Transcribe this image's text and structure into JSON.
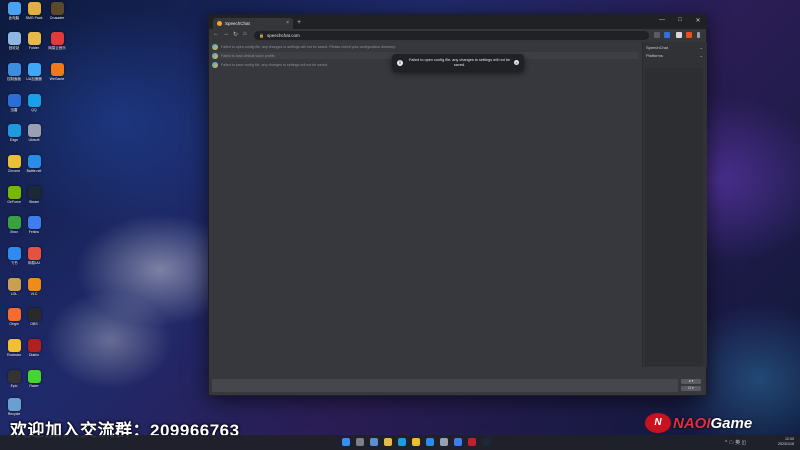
{
  "desktop": {
    "icons": [
      {
        "label": "此电脑",
        "color": "#4aa3f0"
      },
      {
        "label": "SMG Pack",
        "color": "#e0b040"
      },
      {
        "label": "Crusader",
        "color": "#5a4a2a"
      },
      {
        "label": "回收站",
        "color": "#8fb6e0"
      },
      {
        "label": "Folder",
        "color": "#e8b84a"
      },
      {
        "label": "网易云音乐",
        "color": "#e03a3a"
      },
      {
        "label": "控制面板",
        "color": "#3b8de0"
      },
      {
        "label": "UU加速器",
        "color": "#3fa7f5"
      },
      {
        "label": "WeGame",
        "color": "#f07a1a"
      },
      {
        "label": "迅雷",
        "color": "#2b6fd6"
      },
      {
        "label": "QQ",
        "color": "#1aa0e8"
      },
      {
        "label": "Edge",
        "color": "#1d9be0"
      },
      {
        "label": "Ubisoft",
        "color": "#9aa0b0"
      },
      {
        "label": "Chrome",
        "color": "#e8c030"
      },
      {
        "label": "Battle.net",
        "color": "#2a8de8"
      },
      {
        "label": "GeForce",
        "color": "#76b900"
      },
      {
        "label": "Steam",
        "color": "#1b2838"
      },
      {
        "label": "Xbox",
        "color": "#3aa040"
      },
      {
        "label": "Feishu",
        "color": "#3f7cf0"
      },
      {
        "label": "飞书",
        "color": "#2f8bf0"
      },
      {
        "label": "加速器",
        "color": "#34b0a0"
      },
      {
        "label": "网易UU",
        "color": "#e85040"
      },
      {
        "label": "LOL",
        "color": "#c8a050"
      },
      {
        "label": "VLC",
        "color": "#f08a1a"
      },
      {
        "label": "Origin",
        "color": "#f56c2d"
      },
      {
        "label": "OBS",
        "color": "#2a2a2a"
      },
      {
        "label": "Rockstar",
        "color": "#f0c030"
      },
      {
        "label": "Epic",
        "color": "#333333"
      },
      {
        "label": "Diablo",
        "color": "#b02020"
      },
      {
        "label": "Recycle",
        "color": "#6aa0d0"
      },
      {
        "label": "Razer",
        "color": "#44d62c"
      }
    ]
  },
  "browser": {
    "tab_title": "SpeechChat",
    "tab_close": "×",
    "new_tab": "+",
    "win_minimize": "—",
    "win_maximize": "□",
    "win_close": "✕",
    "nav_back": "←",
    "nav_forward": "→",
    "nav_reload": "↻",
    "nav_home": "⌂",
    "url": "speechchat.com",
    "lock": "🔒"
  },
  "messages": [
    "Failed to open config file, any changes to settings will not be saved. Please check your configuration directory.",
    "Failed to load default voice profile.",
    "Failed to save config file, any changes to settings will not be saved."
  ],
  "toast": {
    "icon": "i",
    "text": "Failed to open config file, any changes to settings will not be saved.",
    "close": "×"
  },
  "sidebar": {
    "select1": "SpeechChat",
    "select2": "Platforms",
    "chev": "⌄"
  },
  "send": {
    "btn1": "● ▾",
    "btn2": "⊡ ▾"
  },
  "overlay": {
    "qq_text": "欢迎加入交流群：209966763",
    "logo_mark": "N",
    "logo_name": "NAOI",
    "logo_suffix": "Game"
  },
  "taskbar": {
    "time": "12:00",
    "date": "2023/1/16",
    "tray": "^ ☁ 英 ◫"
  }
}
